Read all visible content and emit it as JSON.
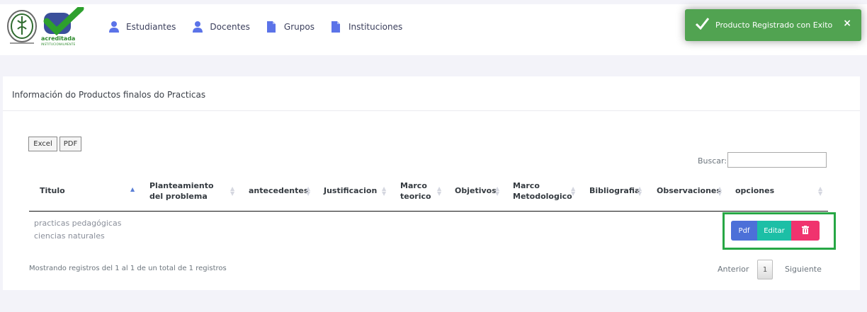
{
  "nav": {
    "items": [
      {
        "label": "Estudiantes",
        "icon": "user-icon"
      },
      {
        "label": "Docentes",
        "icon": "user-icon"
      },
      {
        "label": "Grupos",
        "icon": "document-icon"
      },
      {
        "label": "Instituciones",
        "icon": "document-icon"
      }
    ]
  },
  "logo": {
    "brand": "acreditada",
    "brand_sub": "INSTITUCIONALMENTE"
  },
  "toast": {
    "message": "Producto Registrado con Exito",
    "close": "×",
    "color": "#51a351"
  },
  "card": {
    "title": "Información do Productos finalos do Practicas"
  },
  "export": {
    "excel": "Excel",
    "pdf": "PDF"
  },
  "search": {
    "label": "Buscar:",
    "value": ""
  },
  "table": {
    "headers": [
      "Titulo",
      "Planteamiento del problema",
      "antecedentes",
      "Justificacion",
      "Marco teorico",
      "Objetivos",
      "Marco Metodologico",
      "Bibliografia",
      "Observaciones",
      "opciones"
    ],
    "rows": [
      {
        "titulo_line1": "practicas pedagógicas",
        "titulo_line2": "ciencias naturales"
      }
    ]
  },
  "actions": {
    "pdf": "Pdf",
    "edit": "Editar",
    "delete_icon": "trash-icon"
  },
  "footer": {
    "info": "Mostrando registros del 1 al 1 de un total de 1 registros",
    "prev": "Anterior",
    "page": "1",
    "next": "Siguiente"
  },
  "colors": {
    "pdf": "#4c70d8",
    "edit": "#1cbfa6",
    "delete": "#f0336e",
    "highlight": "#27a745"
  }
}
